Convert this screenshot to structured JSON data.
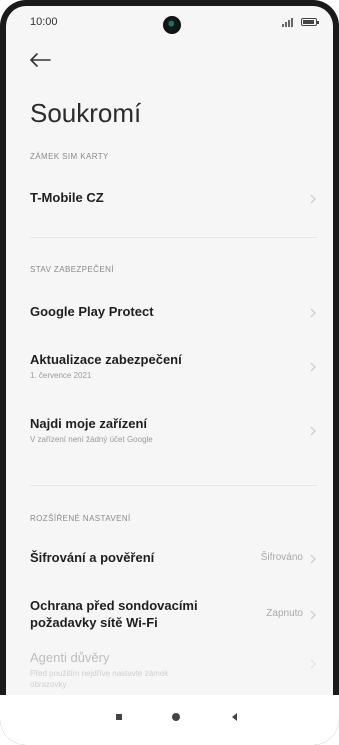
{
  "status": {
    "time": "10:00"
  },
  "page": {
    "title": "Soukromí"
  },
  "sections": {
    "sim": {
      "label": "ZÁMEK SIM KARTY",
      "carrier": "T-Mobile CZ"
    },
    "security": {
      "label": "STAV ZABEZPEČENÍ",
      "play_protect": "Google Play Protect",
      "update_title": "Aktualizace zabezpečení",
      "update_sub": "1. července 2021",
      "find_title": "Najdi moje zařízení",
      "find_sub": "V zařízení není žádný účet Google"
    },
    "advanced": {
      "label": "ROZŠÍŘENÉ NASTAVENÍ",
      "encryption_title": "Šifrování a pověření",
      "encryption_value": "Šifrováno",
      "wifi_title_1": "Ochrana před sondovacími",
      "wifi_title_2": "požadavky sítě Wi-Fi",
      "wifi_value": "Zapnuto",
      "trust_title": "Agenti důvěry",
      "trust_sub_1": "Před použitím nejdříve nastavte zámek",
      "trust_sub_2": "obrazovky"
    }
  },
  "colors": {
    "background": "#f6f6f6",
    "accent": "#1f1f1f"
  },
  "icons": {
    "back": "arrow-left-icon",
    "chevron": "chevron-right-icon",
    "nav_recent": "square-icon",
    "nav_home": "circle-icon",
    "nav_back": "triangle-left-icon"
  }
}
